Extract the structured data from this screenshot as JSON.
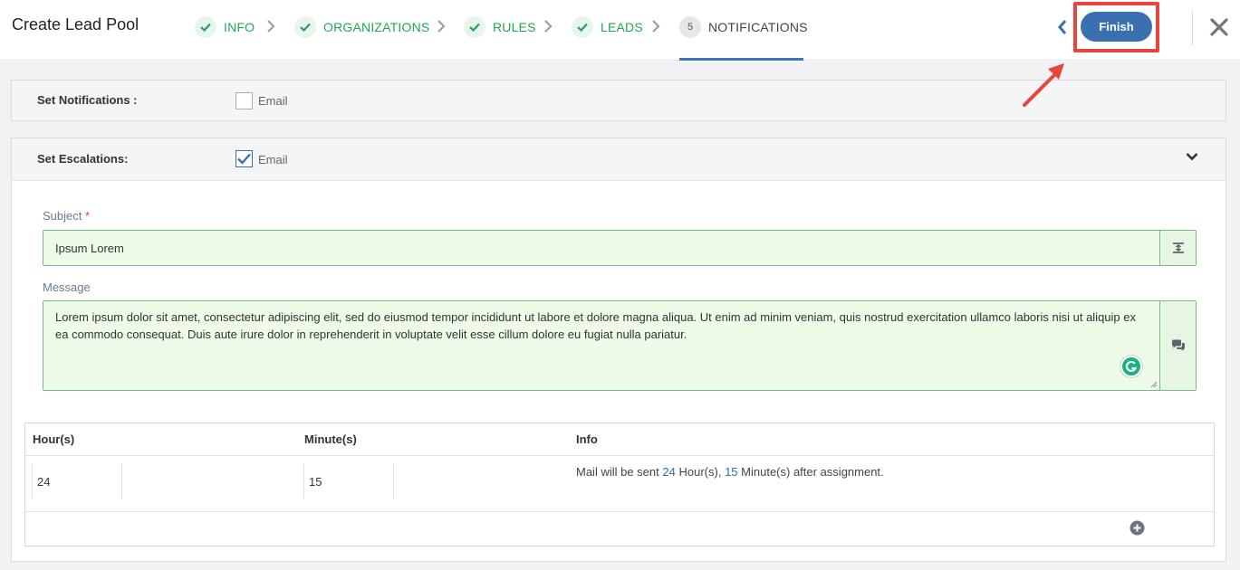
{
  "header": {
    "title": "Create Lead Pool",
    "steps": [
      {
        "label": "INFO",
        "state": "done"
      },
      {
        "label": "ORGANIZATIONS",
        "state": "done"
      },
      {
        "label": "RULES",
        "state": "done"
      },
      {
        "label": "LEADS",
        "state": "done"
      },
      {
        "label": "NOTIFICATIONS",
        "state": "active",
        "number": "5"
      }
    ],
    "finish_label": "Finish",
    "back_icon": "chevron-left-icon",
    "close_icon": "close-icon"
  },
  "notifications": {
    "label": "Set Notifications :",
    "email_label": "Email",
    "email_checked": false
  },
  "escalations": {
    "label": "Set Escalations:",
    "email_label": "Email",
    "email_checked": true,
    "subject_label": "Subject",
    "subject_required": "*",
    "subject_value": "Ipsum Lorem",
    "message_label": "Message",
    "message_value": "Lorem ipsum dolor sit amet, consectetur adipiscing elit, sed do eiusmod tempor incididunt ut labore et dolore magna aliqua. Ut enim ad minim veniam, quis nostrud exercitation ullamco laboris nisi ut aliquip ex ea commodo consequat. Duis aute irure dolor in reprehenderit in voluptate velit esse cillum dolore eu fugiat nulla pariatur.",
    "table": {
      "headers": [
        "Hour(s)",
        "Minute(s)",
        "Info"
      ],
      "hours": "24",
      "minutes": "15",
      "info_prefix": "Mail will be sent",
      "info_hours": "24",
      "info_hours_unit": "Hour(s),",
      "info_minutes": "15",
      "info_suffix": "Minute(s) after assignment."
    }
  },
  "colors": {
    "accent": "#3a70b0",
    "success": "#23a559",
    "highlight": "#e8453c",
    "input_bg": "#eefbe9"
  }
}
